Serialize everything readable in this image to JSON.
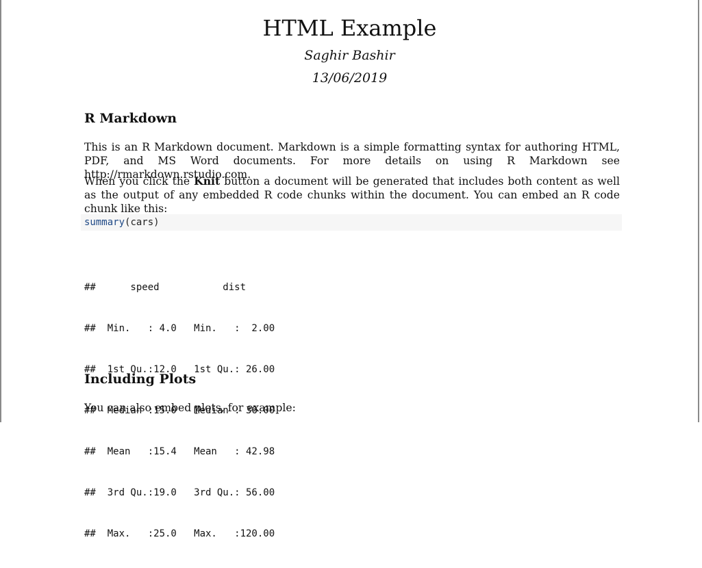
{
  "header": {
    "title": "HTML Example",
    "author": "Saghir Bashir",
    "date": "13/06/2019"
  },
  "section1": {
    "heading": "R Markdown",
    "para1": "This is an R Markdown document. Markdown is a simple formatting syntax for authoring HTML, PDF, and MS Word documents. For more details on using R Markdown see http://rmarkdown.rstudio.com.",
    "para2_before": "When you click the ",
    "para2_bold": "Knit",
    "para2_after": " button a document will be generated that includes both content as well as the output of any embedded R code chunks within the document. You can embed an R code chunk like this:",
    "code_fn": "summary",
    "code_args": "(cars)",
    "output_lines": [
      "##      speed           dist    ",
      "##  Min.   : 4.0   Min.   :  2.00  ",
      "##  1st Qu.:12.0   1st Qu.: 26.00  ",
      "##  Median :15.0   Median : 36.00  ",
      "##  Mean   :15.4   Mean   : 42.98  ",
      "##  3rd Qu.:19.0   3rd Qu.: 56.00  ",
      "##  Max.   :25.0   Max.   :120.00  "
    ]
  },
  "section2": {
    "heading": "Including Plots",
    "para1": "You can also embed plots, for example:"
  }
}
